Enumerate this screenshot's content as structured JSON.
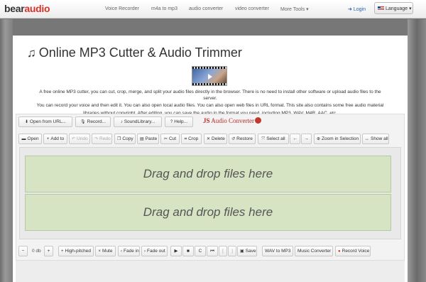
{
  "nav": {
    "logo_part1": "bear",
    "logo_part2": "audio",
    "links": [
      "Voice Recorder",
      "m4a to mp3",
      "audio converter",
      "video converter",
      "More Tools"
    ],
    "more_caret": "▾",
    "login": "Login",
    "language": "Language",
    "language_caret": "▾"
  },
  "page": {
    "title": "Online MP3 Cutter & Audio Trimmer",
    "desc1": "A free online MP3 cutter, you can cut, crop, merge, and split your audio files directly in the browser. There is no need to install other software or upload audio files to the",
    "desc2": "server.",
    "desc3": "You can record your voice and then edit it. You can also open local audio files. You can also open web files in URL format. This site also contains some free audio material",
    "desc4": "libraries without copyright. After editing, you can save the audio in the format you need, including MP3, WAV, M4R, AAC, etc."
  },
  "toolbar1": {
    "open_url": "Open from URL...",
    "record": "Record...",
    "sound_library": "SoundLibrary...",
    "help": "Help...",
    "brand_js": "JS",
    "brand_name": "Audio Converter"
  },
  "toolbar2": {
    "open": "Open",
    "add_to": "Add to",
    "undo": "Undo",
    "redo": "Redo",
    "copy": "Copy",
    "paste": "Paste",
    "cut": "Cut",
    "crop": "Crop",
    "delete": "Delete",
    "restore": "Restore",
    "select_all": "Select all",
    "left": "←",
    "right": "→",
    "zoom_selection": "Zoom in Selection",
    "show_all": "Show all"
  },
  "drop_zones": [
    "Drag and drop files here",
    "Drag and drop files here"
  ],
  "toolbar3": {
    "vol_minus": "−",
    "vol_value": "0 db",
    "vol_plus": "+",
    "high_pitched": "High-pitched",
    "mute": "Mute",
    "fade_in": "Fade in",
    "fade_out": "Fade out",
    "play": "▶",
    "stop": "■",
    "loop": "C",
    "skip_start": "⏮",
    "bracket_open": "[",
    "bracket_close": "]",
    "save": "Save",
    "wav_to_mp3": "WAV to MP3",
    "music_converter": "Music Converter",
    "record_voice": "Record Voice"
  },
  "icons": {
    "note": "music-note-icon",
    "login": "user-icon",
    "flag": "flag-icon"
  },
  "colors": {
    "brand_red": "#d9322b",
    "link_blue": "#1e62b5",
    "drop_green": "#d7e4c4"
  }
}
